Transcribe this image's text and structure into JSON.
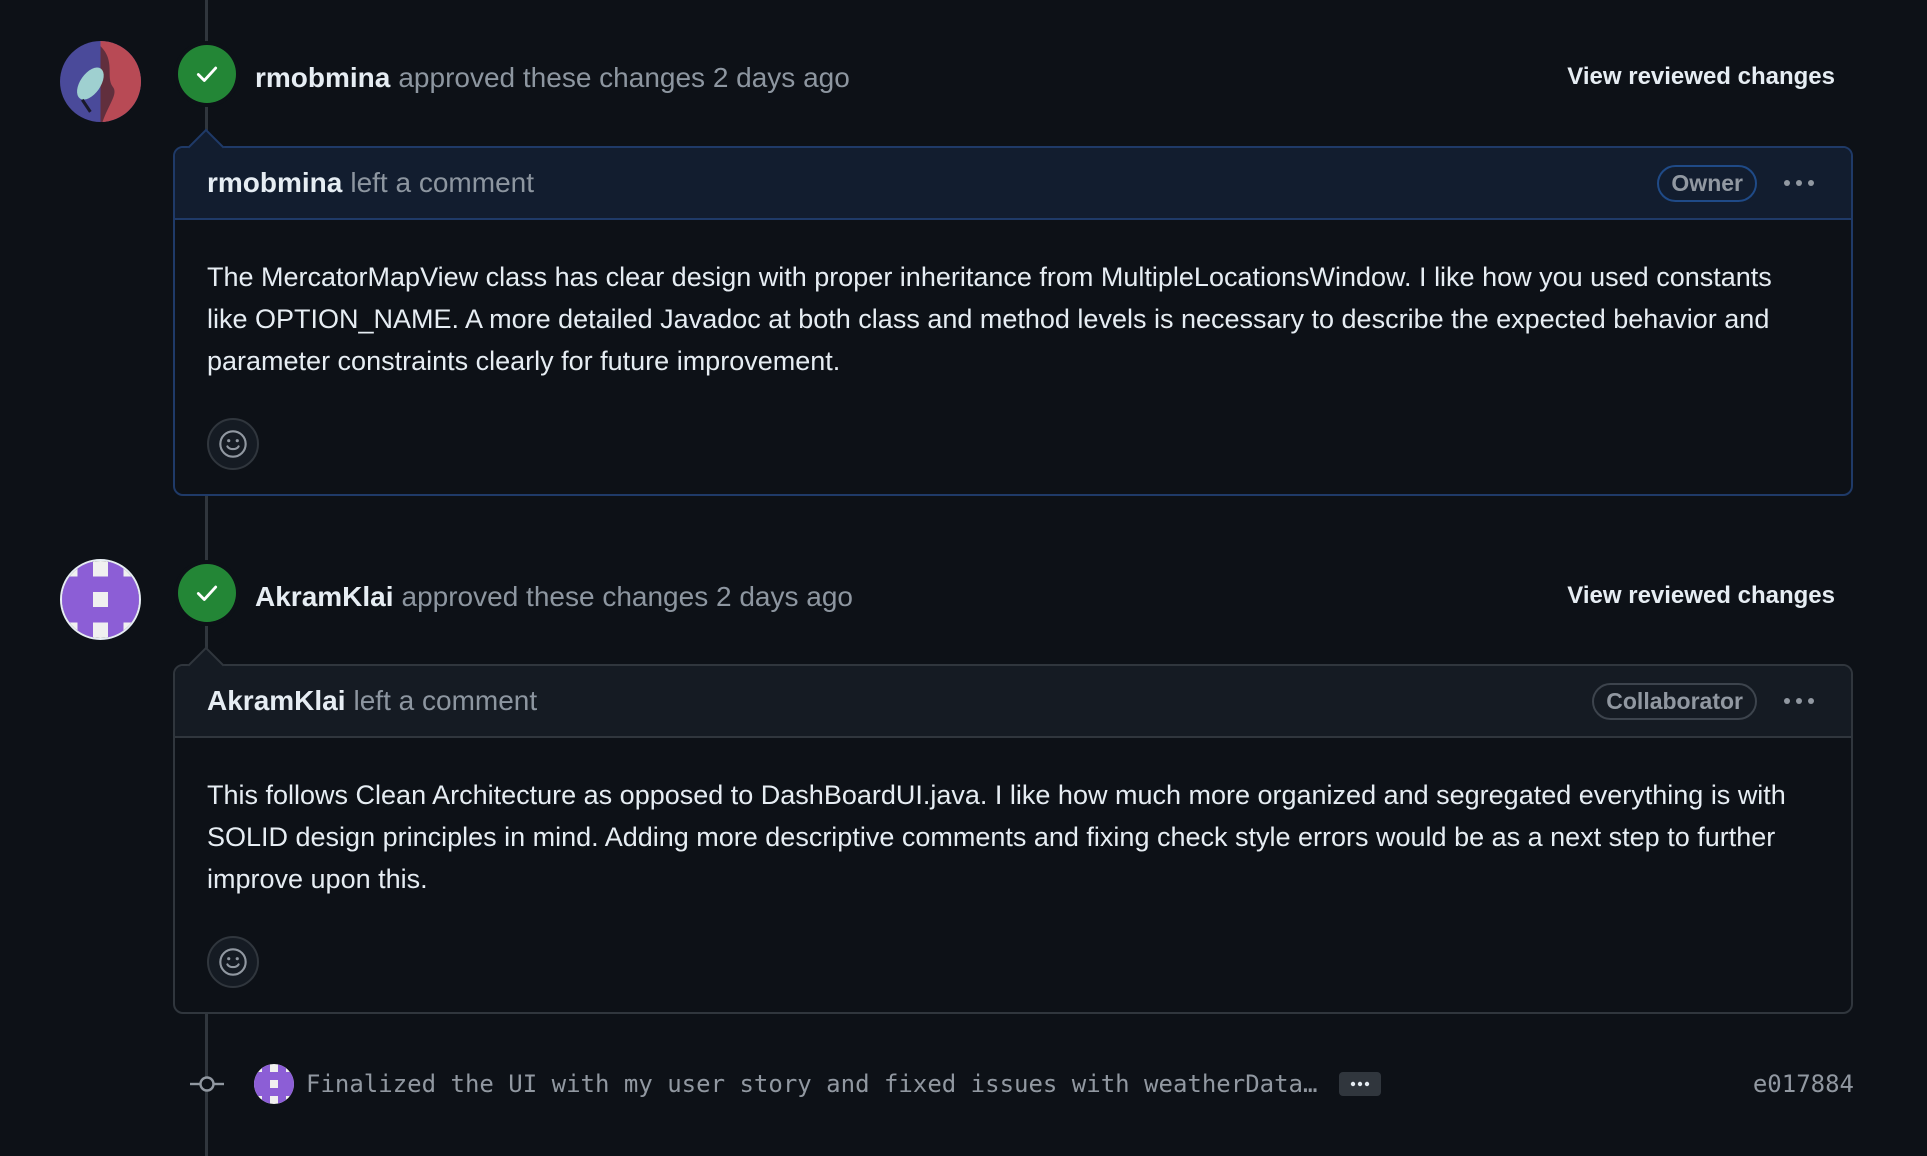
{
  "events": [
    {
      "author": "rmobmina",
      "action": "approved these changes 2 days ago",
      "view_changes": "View reviewed changes",
      "comment": {
        "author": "rmobmina",
        "action": "left a comment",
        "role": "Owner",
        "body": "The MercatorMapView class has clear design with proper inheritance from MultipleLocationsWindow. I like how you used constants like OPTION_NAME. A more detailed Javadoc at both class and method levels is necessary to describe the expected behavior and parameter constraints clearly for future improvement."
      }
    },
    {
      "author": "AkramKlai",
      "action": "approved these changes 2 days ago",
      "view_changes": "View reviewed changes",
      "comment": {
        "author": "AkramKlai",
        "action": "left a comment",
        "role": "Collaborator",
        "body": "This follows Clean Architecture as opposed to DashBoardUI.java. I like how much more organized and segregated everything is with SOLID design principles in mind. Adding more descriptive comments and fixing check style errors would be as a next step to further improve upon this."
      }
    }
  ],
  "commit": {
    "message": "Finalized the UI with my user story and fixed issues with weatherData…",
    "sha": "e017884",
    "icon": "git-commit-icon"
  },
  "colors": {
    "background": "#0d1117",
    "approved_green": "#238636",
    "owner_border": "#1f3a68",
    "text_muted": "#8d96a0"
  }
}
